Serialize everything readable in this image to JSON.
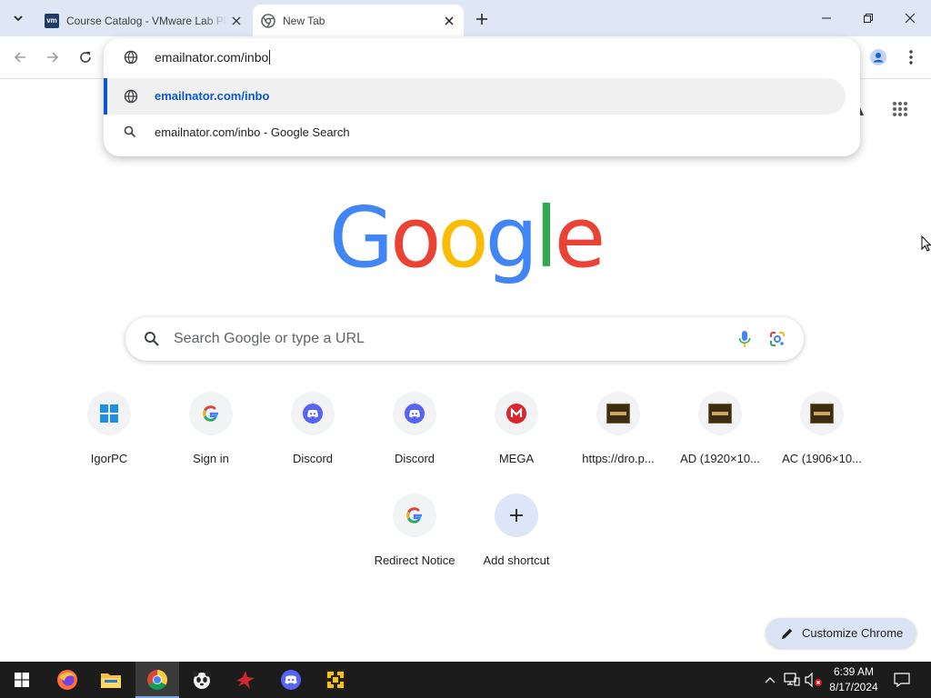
{
  "tabs": [
    {
      "title": "Course Catalog - VMware Lab Platform",
      "favicon": "vmware-icon",
      "active": false
    },
    {
      "title": "New Tab",
      "favicon": "chrome-icon",
      "active": true
    }
  ],
  "omnibox": {
    "input_value": "emailnator.com/inbo",
    "suggestions": [
      {
        "text": "emailnator.com/inbo",
        "icon": "globe-icon",
        "selected": true
      },
      {
        "text": "emailnator.com/inbo - Google Search",
        "icon": "search-icon",
        "selected": false
      }
    ]
  },
  "logo": {
    "letters": [
      "G",
      "o",
      "o",
      "g",
      "l",
      "e"
    ],
    "colors": [
      "#4285f4",
      "#ea4335",
      "#fbbc05",
      "#4285f4",
      "#34a853",
      "#ea4335"
    ]
  },
  "search": {
    "placeholder": "Search Google or type a URL"
  },
  "shortcuts": [
    {
      "label": "IgorPC",
      "icon": "windows-icon"
    },
    {
      "label": "Sign in",
      "icon": "google-icon"
    },
    {
      "label": "Discord",
      "icon": "discord-icon"
    },
    {
      "label": "Discord",
      "icon": "discord-icon"
    },
    {
      "label": "MEGA",
      "icon": "mega-icon"
    },
    {
      "label": "https://dro.p...",
      "icon": "thumbnail-icon"
    },
    {
      "label": "AD (1920×10...",
      "icon": "thumbnail-icon"
    },
    {
      "label": "AC (1906×10...",
      "icon": "thumbnail-icon"
    },
    {
      "label": "Redirect Notice",
      "icon": "google-icon"
    },
    {
      "label": "Add shortcut",
      "icon": "plus-icon"
    }
  ],
  "customize": {
    "label": "Customize Chrome"
  },
  "taskbar": {
    "apps": [
      "start",
      "firefox",
      "file-explorer",
      "chrome",
      "panda",
      "red-app",
      "discord",
      "yellow-app"
    ],
    "clock": {
      "time": "6:39 AM",
      "date": "8/17/2024"
    }
  },
  "colors": {
    "accent": "#0b57d0",
    "tabstrip": "#dfe7f5",
    "taskbar": "#1c1c1c"
  }
}
